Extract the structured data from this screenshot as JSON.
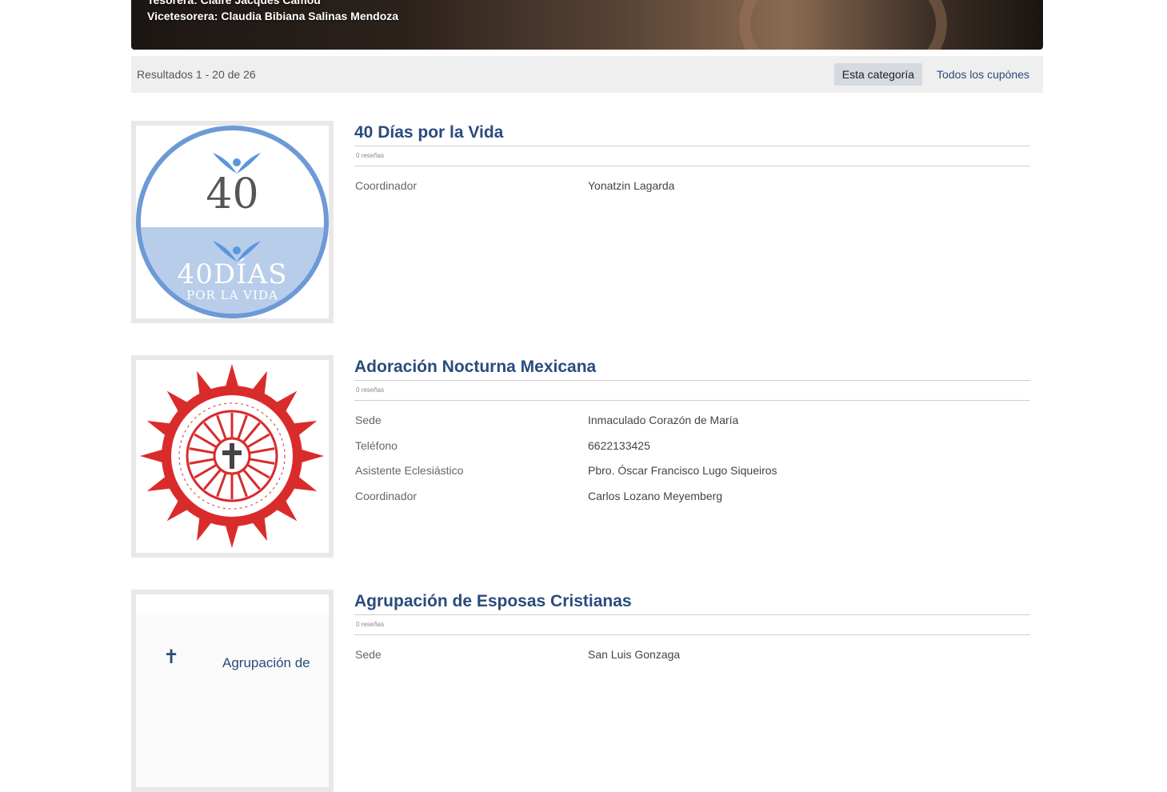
{
  "banner": {
    "line1": "Tesorera: Claire Jacques Camou",
    "line2": "Vicetesorera: Claudia Bibiana Salinas Mendoza"
  },
  "results": {
    "count": "Resultados 1 - 20 de 26",
    "filter_active": "Esta categoría",
    "filter_all": "Todos los cupónes"
  },
  "listings": [
    {
      "title": "40 Días por la Vida",
      "reviews": "0 reseñas",
      "logo_text": {
        "number": "40",
        "name": "40DÍAS",
        "sub": "POR LA VIDA"
      },
      "fields": [
        {
          "label": "Coordinador",
          "value": "Yonatzin Lagarda"
        }
      ]
    },
    {
      "title": "Adoración Nocturna Mexicana",
      "reviews": "0 reseñas",
      "logo_text": "SACRAMENTUM PIETATIS SIGNUM UNITATIS VINCULUM CHARITATIS",
      "fields": [
        {
          "label": "Sede",
          "value": "Inmaculado Corazón de María"
        },
        {
          "label": "Teléfono",
          "value": "6622133425"
        },
        {
          "label": "Asistente Eclesiástico",
          "value": "Pbro. Óscar Francisco Lugo Siqueiros"
        },
        {
          "label": "Coordinador",
          "value": "Carlos Lozano Meyemberg"
        }
      ]
    },
    {
      "title": "Agrupación de Esposas Cristianas",
      "reviews": "0 reseñas",
      "logo_text": "Agrupación de",
      "fields": [
        {
          "label": "Sede",
          "value": "San Luis Gonzaga"
        }
      ]
    }
  ],
  "colors": {
    "link": "#2a4b7c",
    "logo_blue": "#6d9ad6",
    "logo_red": "#d92b2b",
    "bar_bg": "#efefef"
  }
}
